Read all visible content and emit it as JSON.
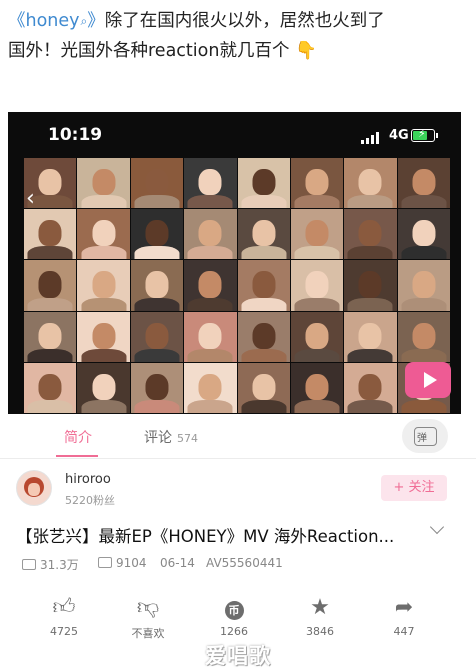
{
  "post": {
    "hashtag_open": "《",
    "hashtag_text": "honey",
    "hashtag_close": "》",
    "line1_rest": "除了在国内很火以外，居然也火到了",
    "line2": "国外！光国外各种reaction就几百个",
    "emoji": "👇"
  },
  "video": {
    "status_time": "10:19",
    "network": "4G",
    "mosaic_colors": [
      "#6e4a3a",
      "#c9b49a",
      "#8a5a3c",
      "#3a3a3a",
      "#d8c2a8",
      "#7a5640",
      "#b3876a",
      "#5b4133",
      "#e2c9b2",
      "#9b6b4f",
      "#2e2e2e",
      "#a58a74",
      "#5a4a40",
      "#c0a088",
      "#77584a",
      "#443a36",
      "#b69274",
      "#e8cdb8",
      "#8a6b52",
      "#3f3431",
      "#a47b63",
      "#d9bfa7",
      "#4e3b30",
      "#ba9c84",
      "#8c7462",
      "#f0d6c4",
      "#6c5346",
      "#c98a7a",
      "#9a7d6a",
      "#5e4538",
      "#caa58c",
      "#7b6351",
      "#e1b7a3",
      "#4a382e",
      "#ad8f78",
      "#f2dccc",
      "#8e6a55",
      "#3b2f2b",
      "#d4ab94",
      "#755a4b"
    ],
    "tile_cols": 8,
    "tile_rows": 5
  },
  "tabs": {
    "intro": "简介",
    "comments": "评论",
    "comments_count": "574",
    "danmaku_label": "弹"
  },
  "author": {
    "name": "hiroroo",
    "fans": "5220粉丝",
    "follow": "+ 关注"
  },
  "title": "【张艺兴】最新EP《HONEY》MV  海外Reaction...",
  "meta": {
    "views": "31.3万",
    "danmaku": "9104",
    "date": "06-14",
    "av": "AV55560441"
  },
  "actions": {
    "like": "4725",
    "dislike": "不喜欢",
    "coin": "1266",
    "favorite": "3846",
    "share": "447"
  },
  "watermark": "爱唱歌",
  "colors": {
    "accent": "#f06d95",
    "link": "#3f8ad0"
  }
}
